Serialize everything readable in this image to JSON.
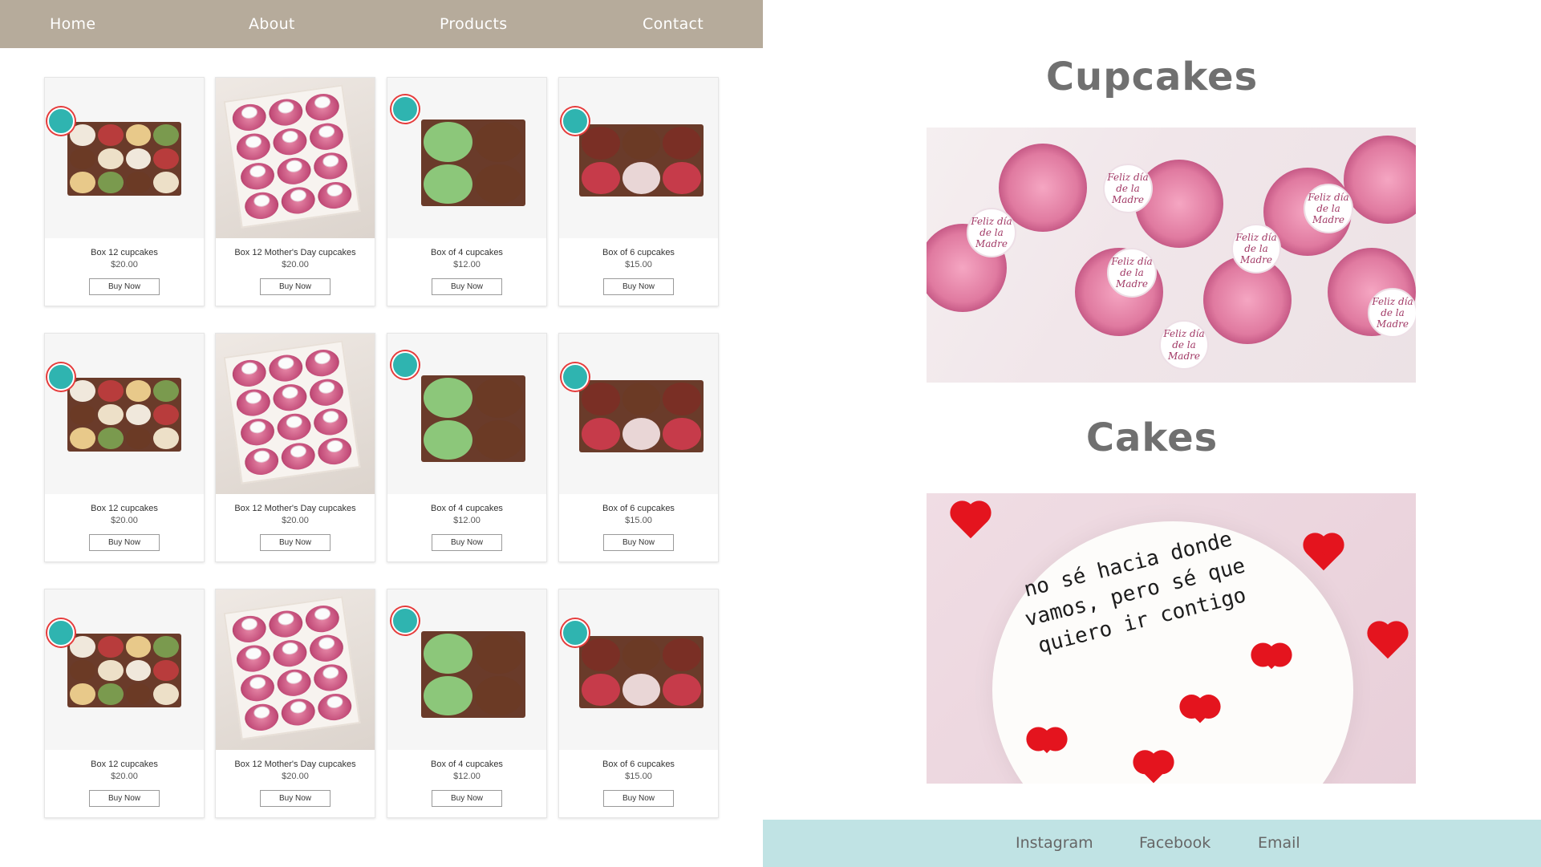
{
  "nav": {
    "items": [
      "Home",
      "About",
      "Products",
      "Contact"
    ]
  },
  "products": [
    {
      "title": "Box 12 cupcakes",
      "price": "$20.00",
      "button": "Buy Now",
      "kind": "box12"
    },
    {
      "title": "Box 12 Mother's Day cupcakes",
      "price": "$20.00",
      "button": "Buy Now",
      "kind": "roses"
    },
    {
      "title": "Box of 4 cupcakes",
      "price": "$12.00",
      "button": "Buy Now",
      "kind": "box4"
    },
    {
      "title": "Box of 6 cupcakes",
      "price": "$15.00",
      "button": "Buy Now",
      "kind": "box6"
    },
    {
      "title": "Box 12 cupcakes",
      "price": "$20.00",
      "button": "Buy Now",
      "kind": "box12"
    },
    {
      "title": "Box 12 Mother's Day cupcakes",
      "price": "$20.00",
      "button": "Buy Now",
      "kind": "roses"
    },
    {
      "title": "Box of 4 cupcakes",
      "price": "$12.00",
      "button": "Buy Now",
      "kind": "box4"
    },
    {
      "title": "Box of 6 cupcakes",
      "price": "$15.00",
      "button": "Buy Now",
      "kind": "box6"
    },
    {
      "title": "Box 12 cupcakes",
      "price": "$20.00",
      "button": "Buy Now",
      "kind": "box12"
    },
    {
      "title": "Box 12 Mother's Day cupcakes",
      "price": "$20.00",
      "button": "Buy Now",
      "kind": "roses"
    },
    {
      "title": "Box of 4 cupcakes",
      "price": "$12.00",
      "button": "Buy Now",
      "kind": "box4"
    },
    {
      "title": "Box of 6 cupcakes",
      "price": "$15.00",
      "button": "Buy Now",
      "kind": "box6"
    }
  ],
  "sections": {
    "cupcakes_title": "Cupcakes",
    "cakes_title": "Cakes",
    "cupcake_tag_text": "Feliz día de la Madre",
    "cake_message": "no sé hacia donde vamos, pero sé que quiero ir contigo"
  },
  "footer": {
    "instagram": "Instagram",
    "facebook": "Facebook",
    "email": "Email"
  },
  "colors": {
    "nav_bg": "#b6ab9b",
    "footer_bg": "#c0e3e4",
    "title_gray": "#707070"
  }
}
